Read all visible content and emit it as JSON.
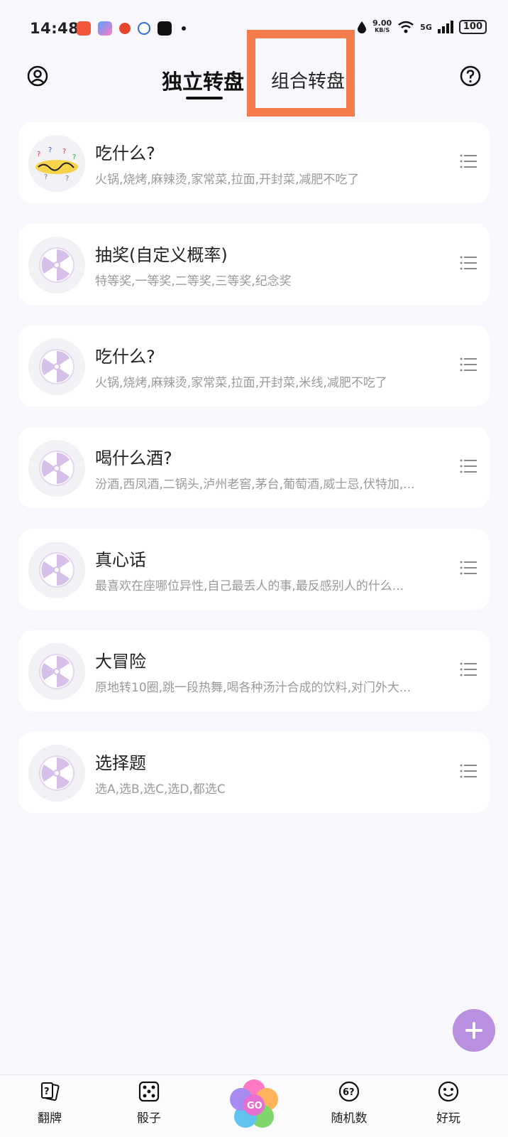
{
  "status_bar": {
    "time": "14:48",
    "net_speed": "9.00",
    "net_unit": "KB/S",
    "signal_label": "5G",
    "battery": "100"
  },
  "header": {
    "tab_independent": "独立转盘",
    "tab_combined": "组合转盘"
  },
  "list": {
    "items": [
      {
        "title": "吃什么?",
        "subtitle": "火锅,烧烤,麻辣烫,家常菜,拉面,开封菜,减肥不吃了",
        "avatar": "custom-sticker"
      },
      {
        "title": "抽奖(自定义概率)",
        "subtitle": "特等奖,一等奖,二等奖,三等奖,纪念奖",
        "avatar": "wheel-icon"
      },
      {
        "title": "吃什么?",
        "subtitle": "火锅,烧烤,麻辣烫,家常菜,拉面,开封菜,米线,减肥不吃了",
        "avatar": "wheel-icon"
      },
      {
        "title": "喝什么酒?",
        "subtitle": "汾酒,西凤酒,二锅头,泸州老窖,茅台,葡萄酒,威士忌,伏特加,...",
        "avatar": "wheel-icon"
      },
      {
        "title": "真心话",
        "subtitle": "最喜欢在座哪位异性,自己最丢人的事,最反感别人的什么...",
        "avatar": "wheel-icon"
      },
      {
        "title": "大冒险",
        "subtitle": "原地转10圈,跳一段热舞,喝各种汤汁合成的饮料,对门外大...",
        "avatar": "wheel-icon"
      },
      {
        "title": "选择题",
        "subtitle": "选A,选B,选C,选D,都选C",
        "avatar": "wheel-icon"
      }
    ]
  },
  "bottom_nav": {
    "flip": "翻牌",
    "dice": "骰子",
    "go": "GO",
    "random": "随机数",
    "fun": "好玩"
  },
  "colors": {
    "accent_purple": "#b98fe0",
    "highlight_orange": "#f47c4c",
    "wheel_purple": "#d6bfe8"
  }
}
